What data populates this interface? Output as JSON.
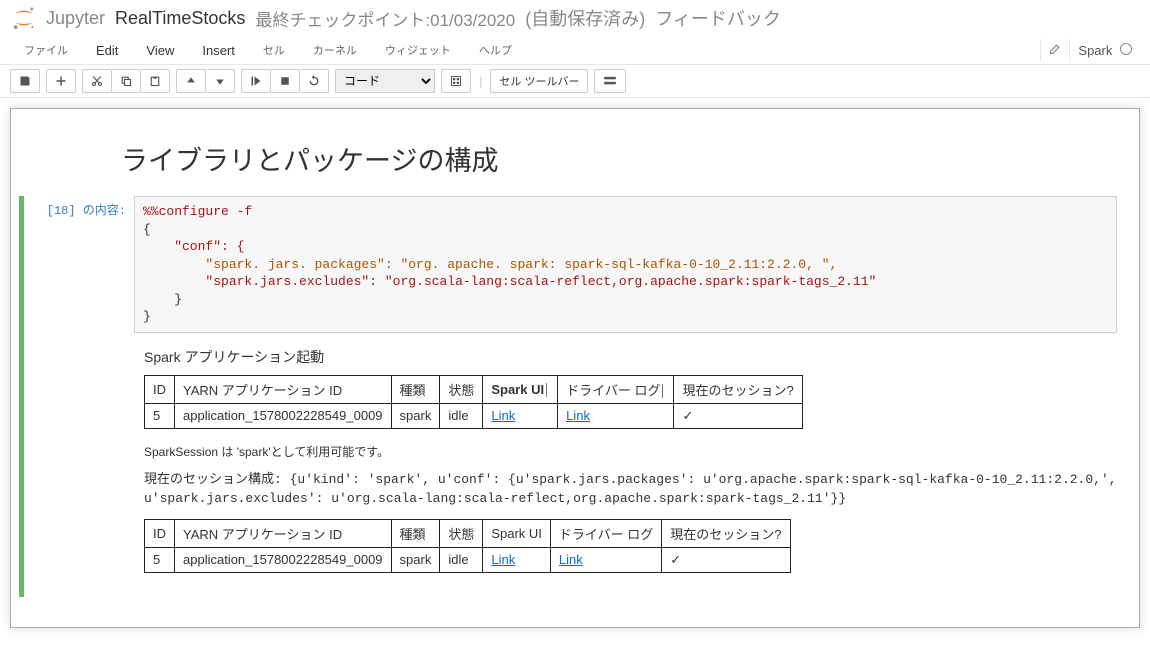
{
  "header": {
    "jupyter": "Jupyter",
    "notebook_name": "RealTimeStocks",
    "checkpoint": "最終チェックポイント:01/03/2020",
    "autosave": "(自動保存済み)",
    "feedback": "フィードバック"
  },
  "menubar": {
    "file": "ファイル",
    "edit": "Edit",
    "view": "View",
    "insert": "Insert",
    "cell": "セル",
    "kernel": "カーネル",
    "widgets": "ウィジェット",
    "help": "ヘルプ",
    "kernel_name": "Spark"
  },
  "toolbar": {
    "cell_type": "コード",
    "cell_toolbar_label": "セル ツールバー"
  },
  "cell": {
    "prompt": "[18] の内容:",
    "code": {
      "magic": "%%configure -f",
      "l1": "{",
      "l2": "    \"conf\": {",
      "l3a": "        \"spark. jars. packages\": \"org. apache. spark: spark-sql-kafka-0-10_2.11:2.2.0, \",",
      "l4a": "        \"spark.jars.excludes\"",
      "l4b": ": ",
      "l4c": "\"org.scala-lang:scala-reflect,org.apache.spark:spark-tags_2.11\"",
      "l5": "    }",
      "l6": "}"
    }
  },
  "output": {
    "start_title": "Spark アプリケーション起動",
    "session_note": "SparkSession は 'spark'として利用可能です。",
    "session_cfg_prefix": "現在のセッション構成: {u'kind':",
    "session_cfg_rest": "  'spark', u'conf': {u'spark.jars.packages': u'org.apache.spark:spark-sql-kafka-0-10_2.11:2.2.0,', u'spark.jars.excludes': u'org.scala-lang:scala-reflect,org.apache.spark:spark-tags_2.11'}}",
    "table1": {
      "headers": {
        "id": "ID",
        "yarn": "YARN アプリケーション ID",
        "kind": "種類",
        "state": "状態",
        "sparkui": "Spark UI",
        "driver": "ドライバー ログ",
        "current": "現在のセッション?"
      },
      "row": {
        "id": "5",
        "yarn": "application_1578002228549_0009",
        "kind": "spark",
        "state": "idle",
        "sparkui": "Link",
        "driver": "Link",
        "current": "✓"
      }
    },
    "table2": {
      "headers": {
        "id": "ID",
        "yarn": "YARN アプリケーション ID",
        "kind": "種類",
        "state": "状態",
        "sparkui": "Spark UI",
        "driver": "ドライバー ログ",
        "current": "現在のセッション?"
      },
      "row": {
        "id": "5",
        "yarn": "application_1578002228549_0009",
        "kind": "spark",
        "state": "idle",
        "sparkui": "Link",
        "driver": "Link",
        "current": "✓"
      }
    }
  },
  "markdown": {
    "heading": "ライブラリとパッケージの構成"
  }
}
